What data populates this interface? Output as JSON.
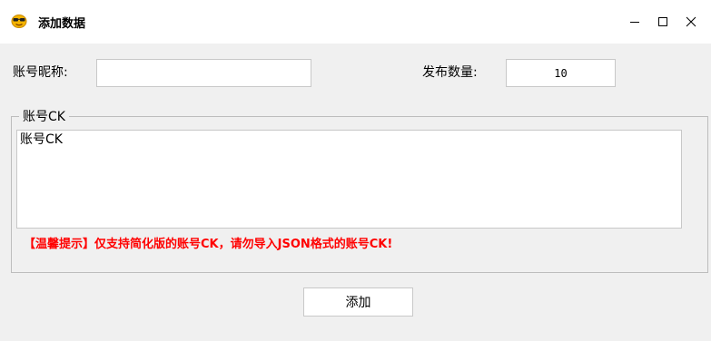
{
  "window": {
    "title": "添加数据",
    "icon": "sunglasses-face-icon",
    "controls": {
      "minimize": "minimize-icon",
      "maximize": "maximize-icon",
      "close": "close-icon"
    }
  },
  "form": {
    "nickname_label": "账号昵称:",
    "nickname_value": "",
    "quantity_label": "发布数量:",
    "quantity_value": "10"
  },
  "group": {
    "title": "账号CK",
    "textarea_value": "账号CK",
    "tip": "【温馨提示】仅支持简化版的账号CK，请勿导入JSON格式的账号CK!"
  },
  "actions": {
    "add_label": "添加"
  },
  "colors": {
    "tip": "#ff0000",
    "titlebar": "#ffffff",
    "body": "#f0f0f0"
  }
}
